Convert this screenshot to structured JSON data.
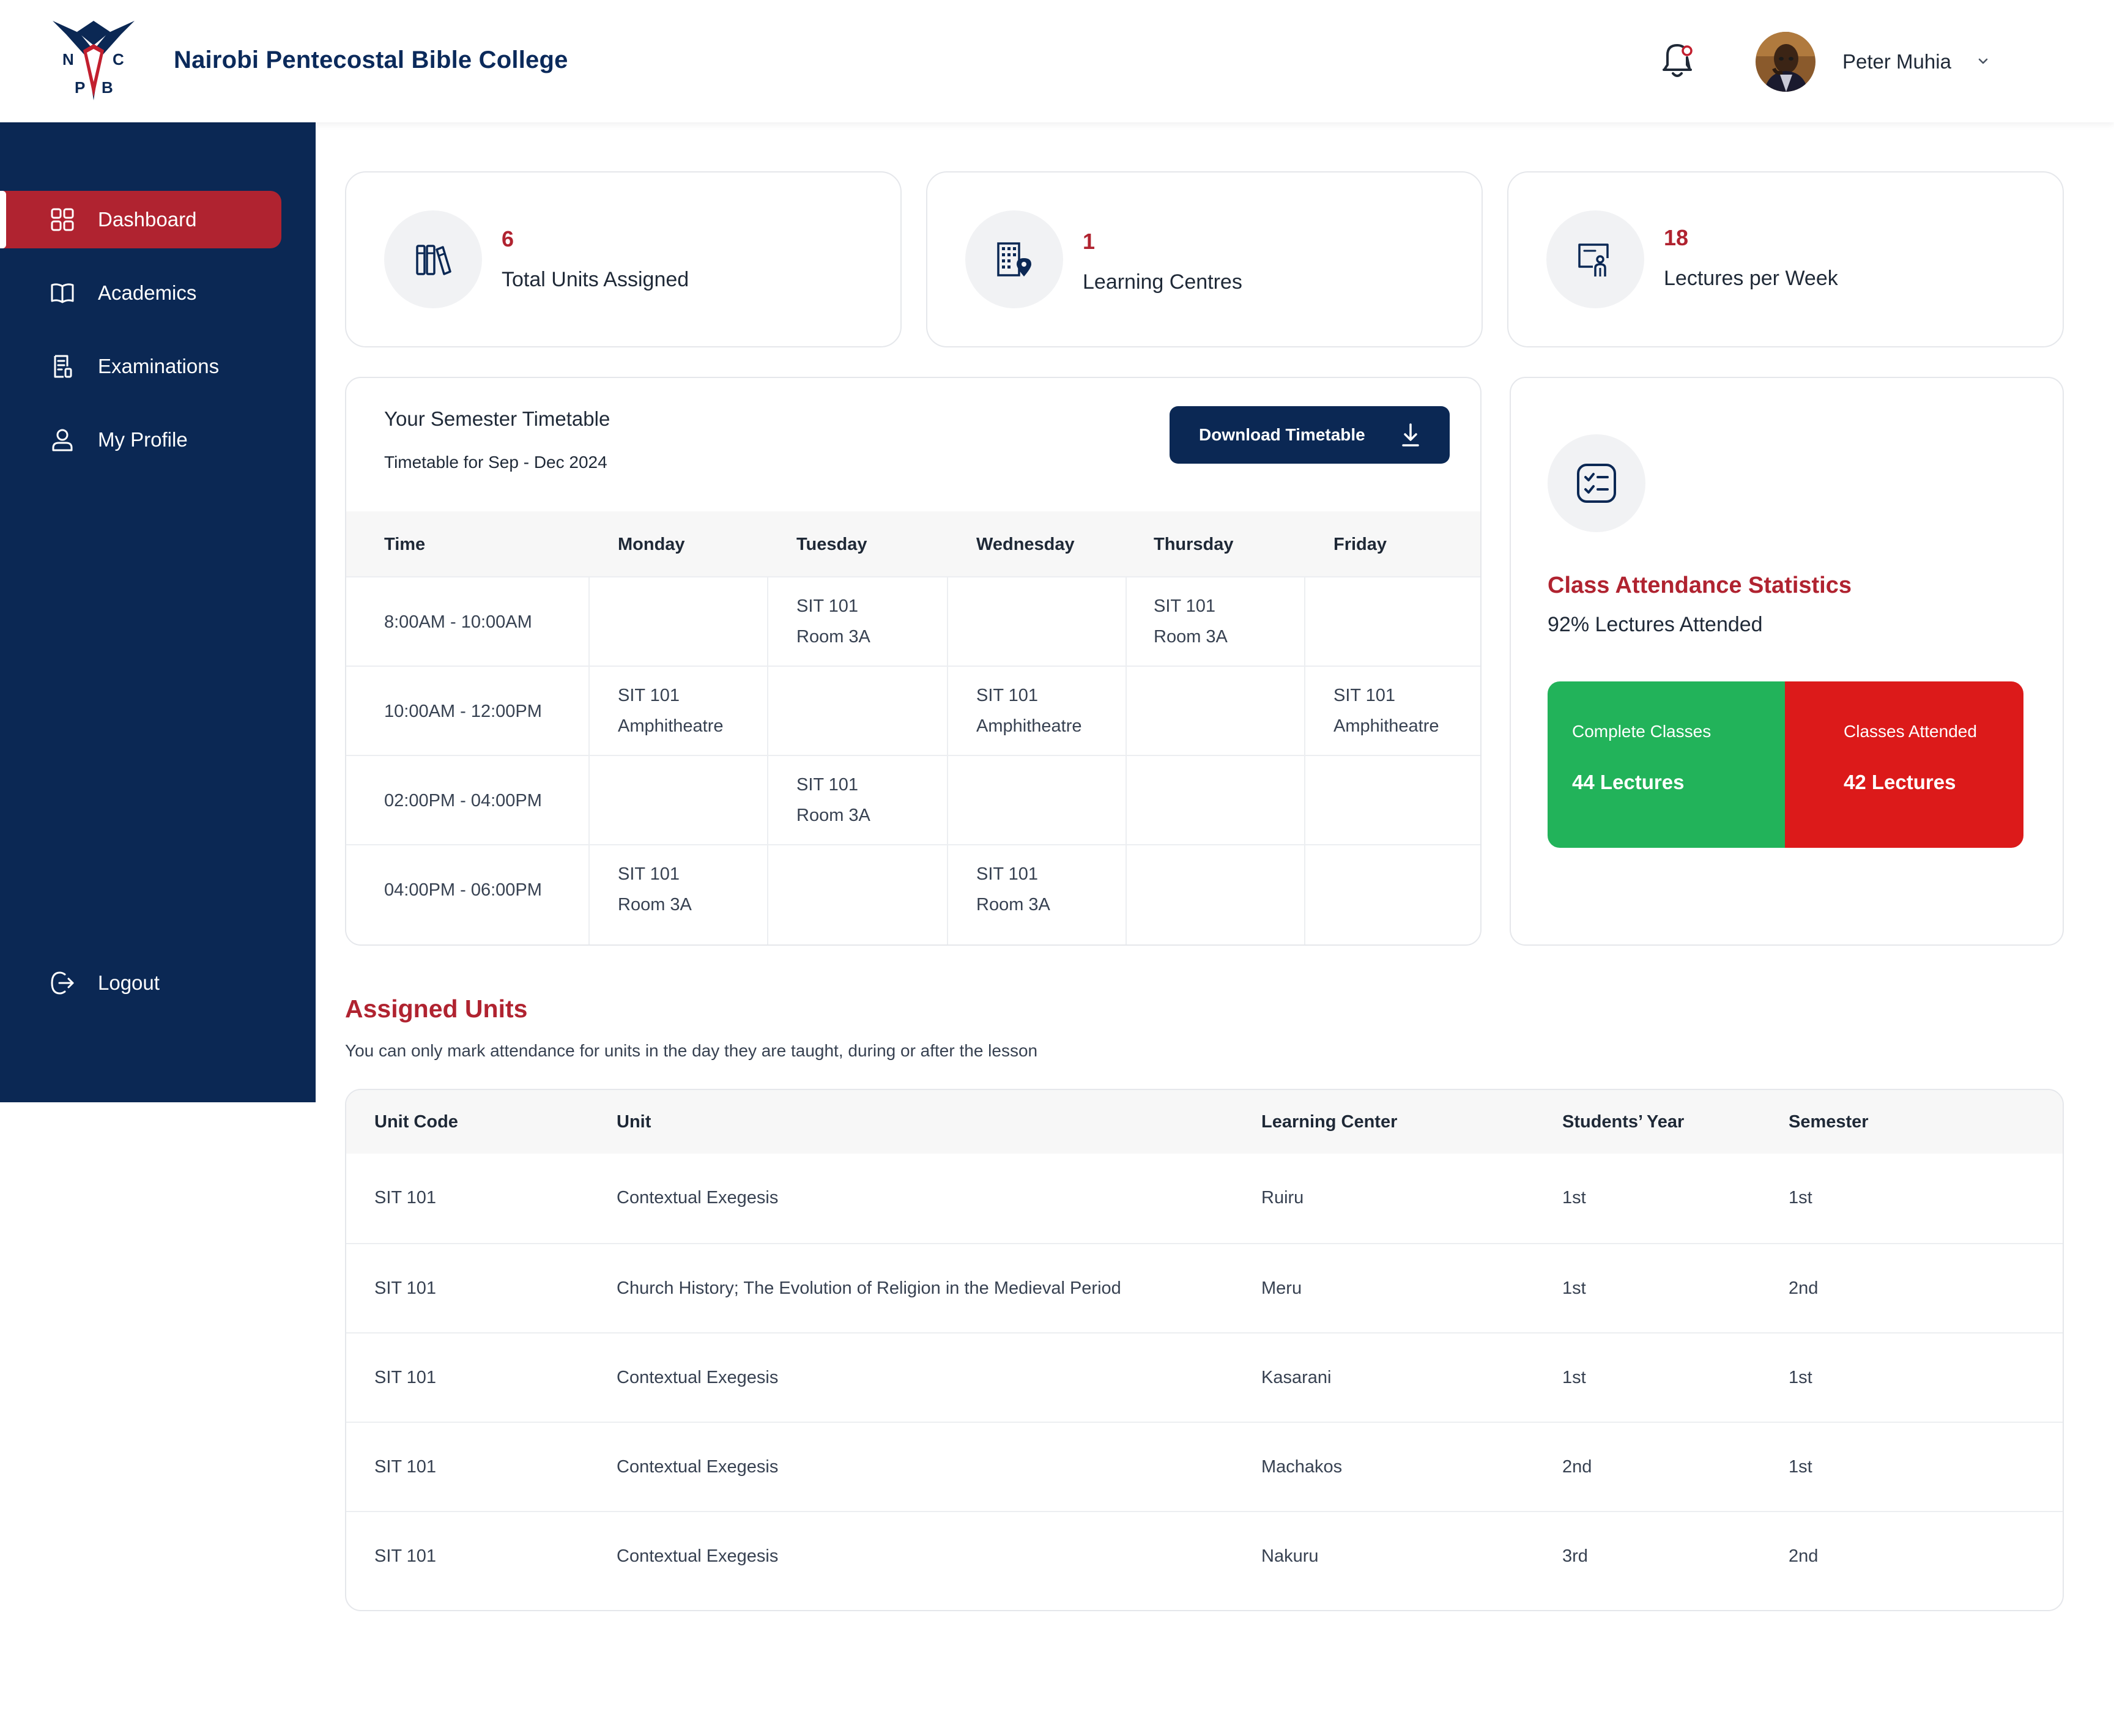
{
  "header": {
    "college_name": "Nairobi Pentecostal Bible College",
    "logo_letters": [
      "N",
      "C",
      "P",
      "B"
    ],
    "user_name": "Peter Muhia"
  },
  "sidebar": {
    "items": [
      {
        "label": "Dashboard",
        "icon": "grid-icon",
        "active": true
      },
      {
        "label": "Academics",
        "icon": "book-open-icon",
        "active": false
      },
      {
        "label": "Examinations",
        "icon": "exam-document-icon",
        "active": false
      },
      {
        "label": "My Profile",
        "icon": "user-icon",
        "active": false
      }
    ],
    "logout_label": "Logout"
  },
  "stats": [
    {
      "value": "6",
      "label": "Total Units Assigned",
      "icon": "books-icon"
    },
    {
      "value": "1",
      "label": "Learning Centres",
      "icon": "building-location-icon"
    },
    {
      "value": "18",
      "label": "Lectures per Week",
      "icon": "lecture-board-icon"
    }
  ],
  "timetable": {
    "title": "Your Semester Timetable",
    "subtitle": "Timetable for Sep - Dec 2024",
    "download_label": "Download Timetable",
    "columns": [
      "Time",
      "Monday",
      "Tuesday",
      "Wednesday",
      "Thursday",
      "Friday"
    ],
    "rows": [
      {
        "time": "8:00AM - 10:00AM",
        "cells": [
          null,
          {
            "unit": "SIT 101",
            "room": "Room 3A"
          },
          null,
          {
            "unit": "SIT 101",
            "room": "Room 3A"
          },
          null
        ]
      },
      {
        "time": "10:00AM - 12:00PM",
        "cells": [
          {
            "unit": "SIT 101",
            "room": "Amphitheatre"
          },
          null,
          {
            "unit": "SIT 101",
            "room": "Amphitheatre"
          },
          null,
          {
            "unit": "SIT 101",
            "room": "Amphitheatre"
          }
        ]
      },
      {
        "time": "02:00PM - 04:00PM",
        "cells": [
          null,
          {
            "unit": "SIT 101",
            "room": "Room 3A"
          },
          null,
          null,
          null
        ]
      },
      {
        "time": "04:00PM - 06:00PM",
        "cells": [
          {
            "unit": "SIT 101",
            "room": "Room 3A"
          },
          null,
          {
            "unit": "SIT 101",
            "room": "Room 3A"
          },
          null,
          null
        ]
      }
    ]
  },
  "attendance": {
    "title": "Class Attendance Statistics",
    "subtitle": "92% Lectures Attended",
    "complete_label": "Complete Classes",
    "complete_value": "44 Lectures",
    "attended_label": "Classes Attended",
    "attended_value": "42 Lectures",
    "colors": {
      "complete": "#22b35a",
      "attended": "#dc1a1a"
    }
  },
  "assigned_units": {
    "title": "Assigned Units",
    "subtitle": "You can only mark attendance for units in the day they are taught, during or after the lesson",
    "columns": [
      "Unit Code",
      "Unit",
      "Learning Center",
      "Students’ Year",
      "Semester"
    ],
    "rows": [
      [
        "SIT 101",
        "Contextual Exegesis",
        "Ruiru",
        "1st",
        "1st"
      ],
      [
        "SIT 101",
        "Church History; The Evolution of Religion in the Medieval Period",
        "Meru",
        "1st",
        "2nd"
      ],
      [
        "SIT 101",
        "Contextual Exegesis",
        "Kasarani",
        "1st",
        "1st"
      ],
      [
        "SIT 101",
        "Contextual Exegesis",
        "Machakos",
        "2nd",
        "1st"
      ],
      [
        "SIT 101",
        "Contextual Exegesis",
        "Nakuru",
        "3rd",
        "2nd"
      ]
    ]
  },
  "colors": {
    "brand_navy": "#0b2854",
    "brand_red": "#b02330"
  }
}
